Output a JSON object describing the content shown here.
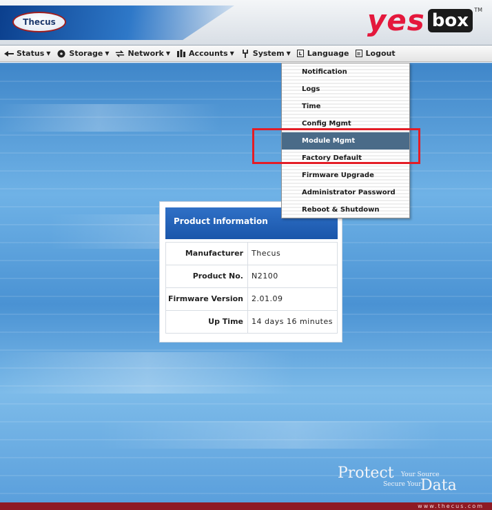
{
  "header": {
    "logo_text": "Thecus",
    "brand_yes": "yes",
    "brand_box": "box",
    "trademark": "TM"
  },
  "nav": {
    "items": [
      {
        "label": "Status",
        "icon": "status-icon"
      },
      {
        "label": "Storage",
        "icon": "storage-icon"
      },
      {
        "label": "Network",
        "icon": "network-icon"
      },
      {
        "label": "Accounts",
        "icon": "accounts-icon"
      },
      {
        "label": "System",
        "icon": "system-icon"
      },
      {
        "label": "Language",
        "icon": "language-icon"
      },
      {
        "label": "Logout",
        "icon": "logout-icon"
      }
    ]
  },
  "system_menu": {
    "items": [
      "Notification",
      "Logs",
      "Time",
      "Config Mgmt",
      "Module Mgmt",
      "Factory Default",
      "Firmware Upgrade",
      "Administrator Password",
      "Reboot & Shutdown"
    ],
    "active_item": "Module Mgmt",
    "highlight_color": "#e41c25"
  },
  "product_info": {
    "title": "Product Information",
    "rows": [
      {
        "label": "Manufacturer",
        "value": "Thecus"
      },
      {
        "label": "Product No.",
        "value": "N2100"
      },
      {
        "label": "Firmware Version",
        "value": "2.01.09"
      },
      {
        "label": "Up Time",
        "value": "14 days 16 minutes"
      }
    ]
  },
  "tagline": {
    "protect": "Protect",
    "your_source": "Your Source",
    "secure_your": "Secure Your",
    "data": "Data"
  },
  "footer": {
    "url": "www.thecus.com"
  },
  "colors": {
    "panel_header": "#1a56aa",
    "active_menu": "#4a6b88",
    "footer": "#8e1a24"
  }
}
